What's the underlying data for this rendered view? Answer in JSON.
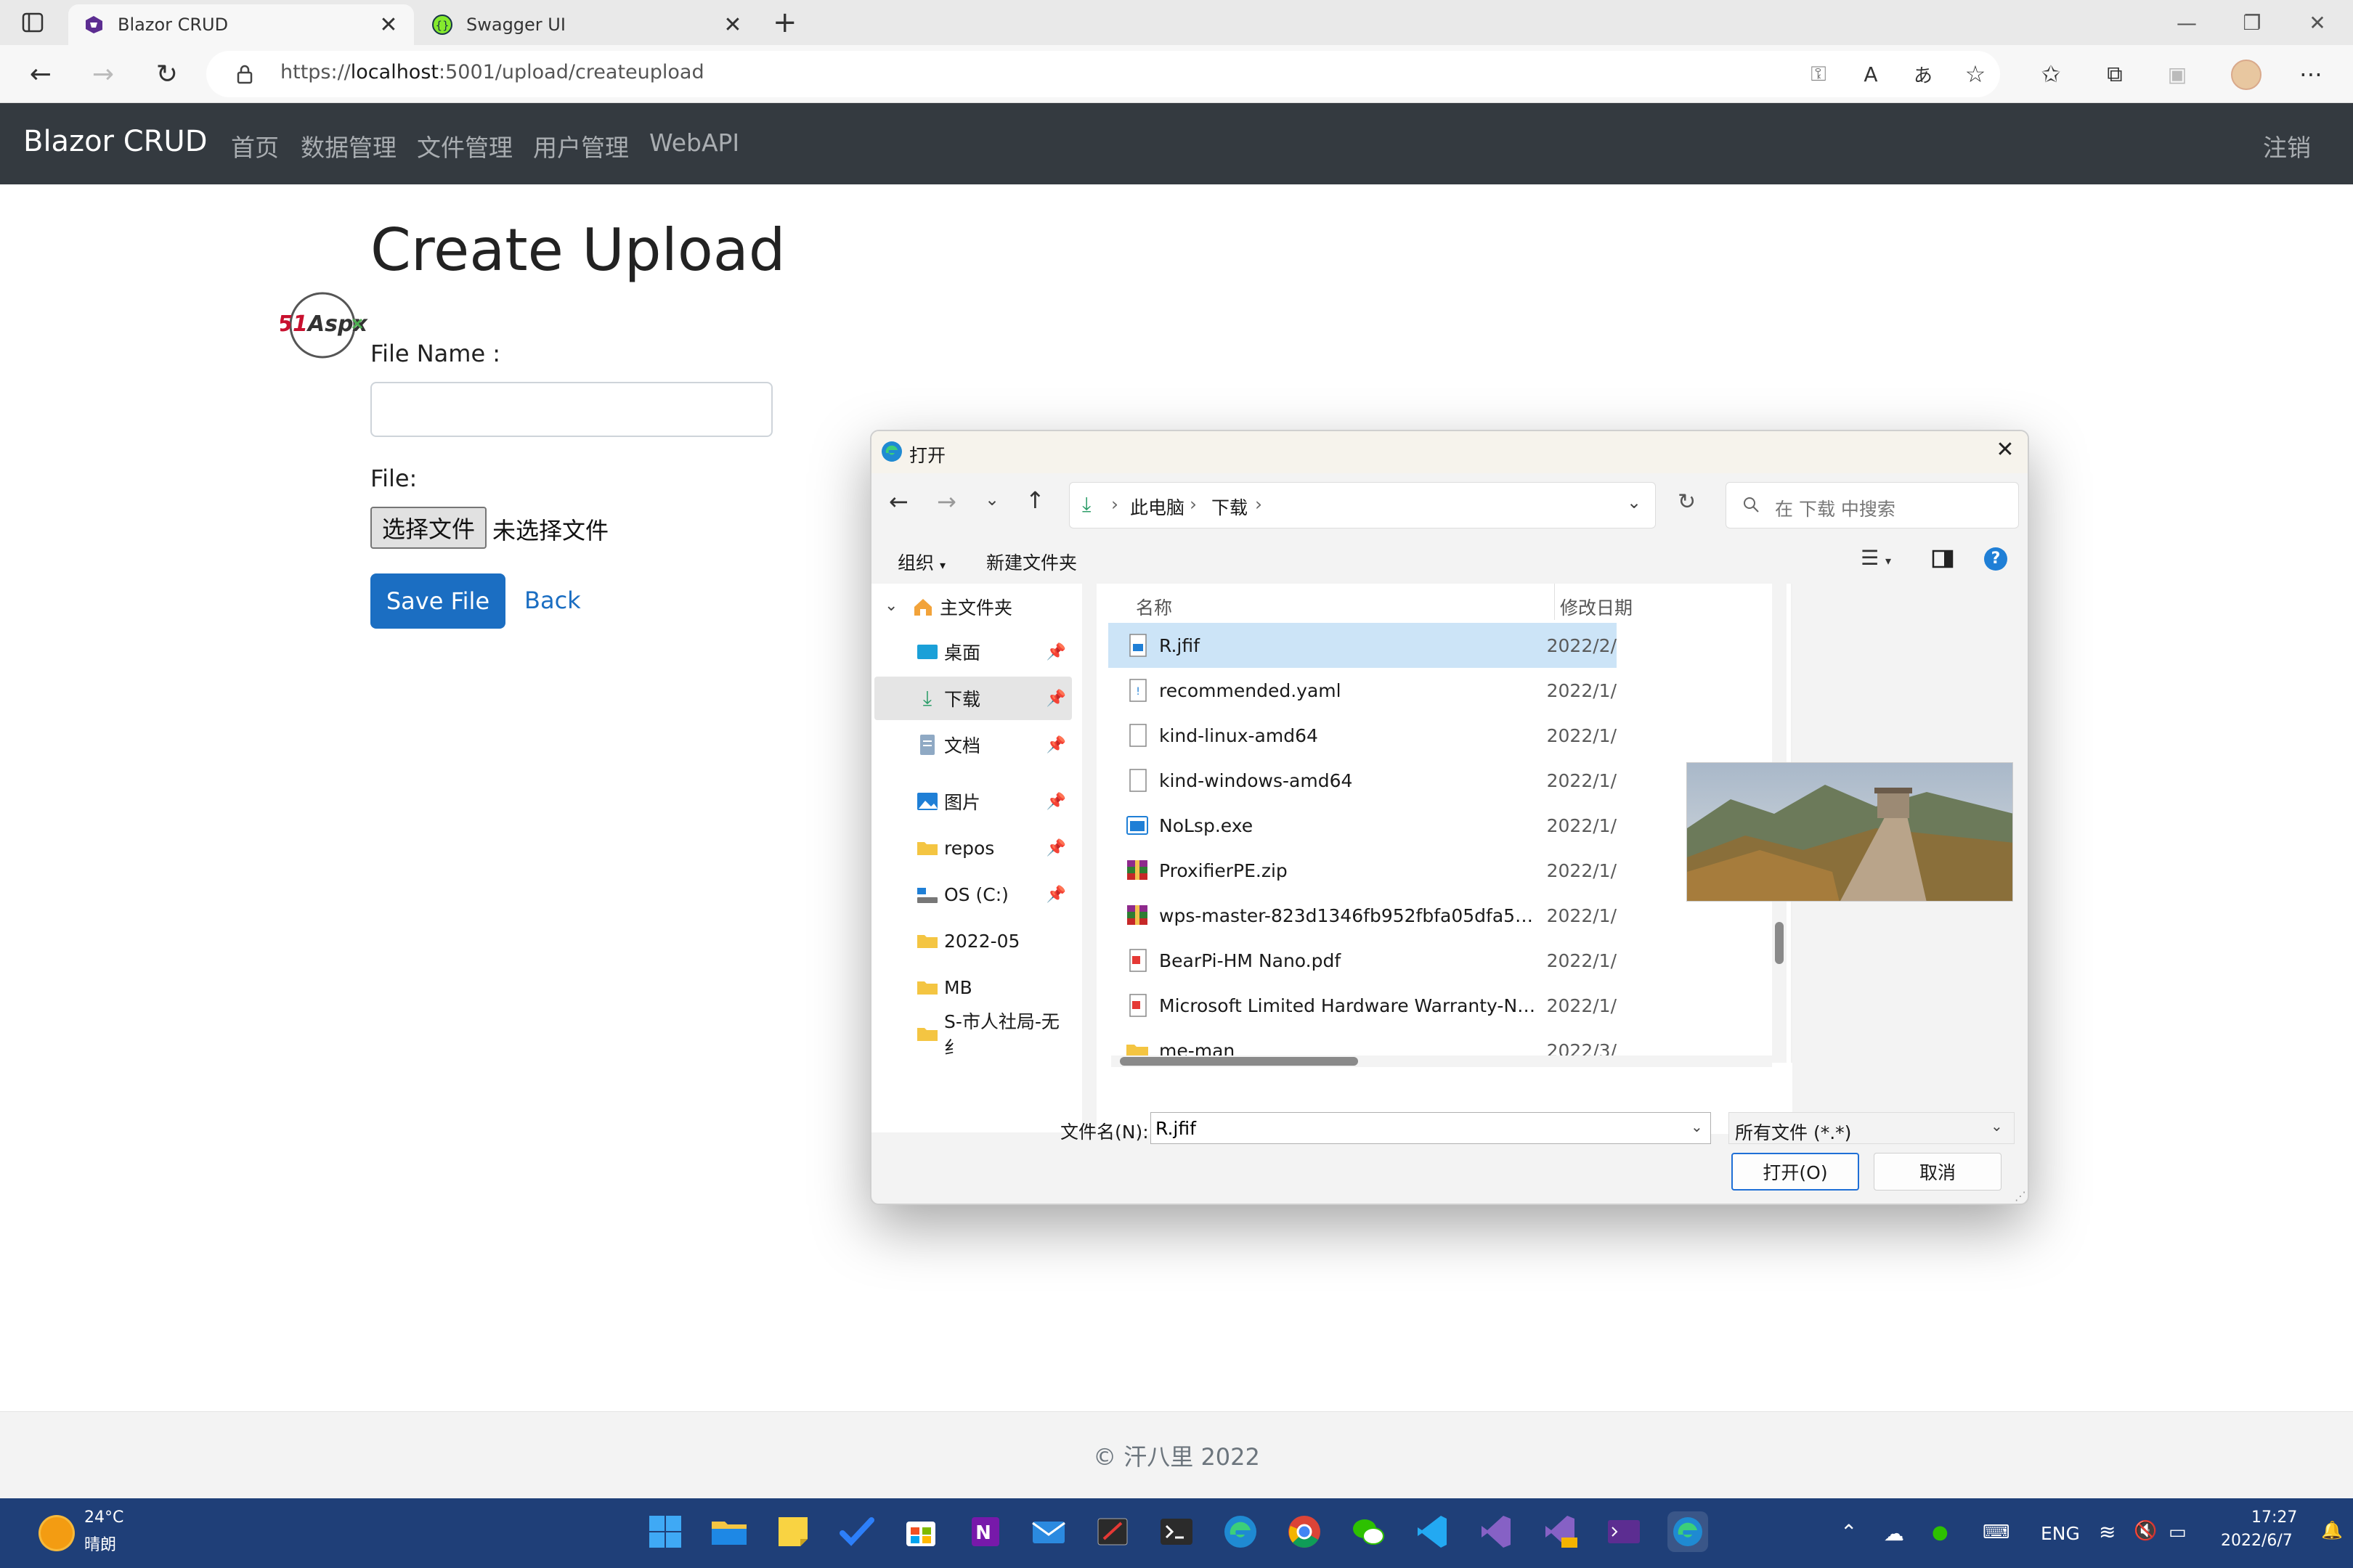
{
  "browser": {
    "tabs": [
      {
        "title": "Blazor CRUD",
        "active": true
      },
      {
        "title": "Swagger UI",
        "active": false
      }
    ],
    "url_prefix": "https://",
    "url_host": "localhost",
    "url_rest": ":5001/upload/createupload"
  },
  "navbar": {
    "brand": "Blazor CRUD",
    "links": [
      "首页",
      "数据管理",
      "文件管理",
      "用户管理",
      "WebAPI"
    ],
    "logout": "注销"
  },
  "page": {
    "title": "Create Upload",
    "logo_text": "51Aspx",
    "file_name_label": "File Name :",
    "file_name_value": "",
    "file_label": "File:",
    "choose_button": "选择文件",
    "no_file_text": "未选择文件",
    "save_button": "Save File",
    "back_link": "Back",
    "footer": "© 汗八里 2022"
  },
  "dialog": {
    "title": "打开",
    "breadcrumb": [
      "此电脑",
      "下载"
    ],
    "search_placeholder": "在 下载 中搜索",
    "organize": "组织",
    "new_folder": "新建文件夹",
    "col_name": "名称",
    "col_date": "修改日期",
    "sidebar": [
      {
        "label": "主文件夹",
        "icon": "home-icon",
        "pinned": false
      },
      {
        "label": "桌面",
        "icon": "desktop-icon",
        "pinned": true
      },
      {
        "label": "下载",
        "icon": "download-icon",
        "pinned": true
      },
      {
        "label": "文档",
        "icon": "documents-icon",
        "pinned": true
      },
      {
        "label": "图片",
        "icon": "pictures-icon",
        "pinned": true
      },
      {
        "label": "repos",
        "icon": "folder-icon",
        "pinned": true
      },
      {
        "label": "OS (C:)",
        "icon": "drive-icon",
        "pinned": true
      },
      {
        "label": "2022-05",
        "icon": "folder-icon",
        "pinned": false
      },
      {
        "label": "MB",
        "icon": "folder-icon",
        "pinned": false
      },
      {
        "label": "S-市人社局-无纟",
        "icon": "folder-icon",
        "pinned": false
      }
    ],
    "files": [
      {
        "name": "R.jfif",
        "date": "2022/2/",
        "icon": "image-file-icon",
        "selected": true
      },
      {
        "name": "recommended.yaml",
        "date": "2022/1/",
        "icon": "text-file-icon",
        "selected": false
      },
      {
        "name": "kind-linux-amd64",
        "date": "2022/1/",
        "icon": "file-icon",
        "selected": false
      },
      {
        "name": "kind-windows-amd64",
        "date": "2022/1/",
        "icon": "file-icon",
        "selected": false
      },
      {
        "name": "NoLsp.exe",
        "date": "2022/1/",
        "icon": "exe-file-icon",
        "selected": false
      },
      {
        "name": "ProxifierPE.zip",
        "date": "2022/1/",
        "icon": "archive-icon",
        "selected": false
      },
      {
        "name": "wps-master-823d1346fb952fbfa05dfa58246...",
        "date": "2022/1/",
        "icon": "archive-icon",
        "selected": false
      },
      {
        "name": "BearPi-HM Nano.pdf",
        "date": "2022/1/",
        "icon": "pdf-file-icon",
        "selected": false
      },
      {
        "name": "Microsoft Limited Hardware Warranty-Nort...",
        "date": "2022/1/",
        "icon": "pdf-file-icon",
        "selected": false
      },
      {
        "name": "me-man",
        "date": "2022/3/",
        "icon": "folder-icon",
        "selected": false
      }
    ],
    "filename_label": "文件名(N):",
    "filename_value": "R.jfif",
    "filter_value": "所有文件 (*.*)",
    "open_button": "打开(O)",
    "cancel_button": "取消"
  },
  "taskbar": {
    "weather_temp": "24°C",
    "weather_desc": "晴朗",
    "lang": "ENG",
    "time": "17:27",
    "date": "2022/6/7"
  },
  "colors": {
    "navbar_bg": "#343a40",
    "primary": "#1b6ec2",
    "selection": "#cce4f7",
    "taskbar_bg": "#1f3f78"
  }
}
